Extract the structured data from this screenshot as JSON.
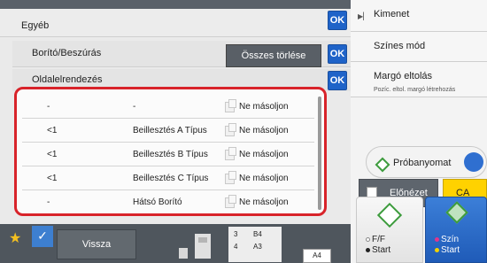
{
  "dialog": {
    "title": "Egyéb",
    "ok_label": "OK",
    "section1_label": "Borító/Beszúrás",
    "clear_all_label": "Összes törlése",
    "section2_label": "Oldalelrendezés",
    "rows": [
      {
        "page": "-",
        "type": "-",
        "copy": "Ne másoljon"
      },
      {
        "page": "<1",
        "type": "Beillesztés A Típus",
        "copy": "Ne másoljon"
      },
      {
        "page": "<1",
        "type": "Beillesztés B Típus",
        "copy": "Ne másoljon"
      },
      {
        "page": "<1",
        "type": "Beillesztés C Típus",
        "copy": "Ne másoljon"
      },
      {
        "page": "-",
        "type": "Hátsó Borító",
        "copy": "Ne másoljon"
      }
    ]
  },
  "right_panel": {
    "items": [
      {
        "label": "Kimenet",
        "sub": ""
      },
      {
        "label": "Színes mód",
        "sub": ""
      },
      {
        "label": "Margó eltolás",
        "sub": "Pozíc. eltol. margó létrehozás"
      }
    ],
    "probe_label": "Próbanyomat",
    "preview_label": "Előnézet",
    "ca_label": "CA",
    "bw_start_line1": "F/F",
    "bw_start_line2": "Start",
    "color_start_line1": "Szín",
    "color_start_line2": "Start"
  },
  "bottom_bar": {
    "back_label": "Vissza",
    "paper": [
      {
        "tray": "3",
        "size": "B4"
      },
      {
        "tray": "4",
        "size": "A3"
      }
    ],
    "current_size": "A4"
  },
  "colors": {
    "highlight_red": "#d8232a",
    "ok_blue": "#1f63c8",
    "ca_yellow": "#ffd200",
    "start_green": "#3c9b3c"
  }
}
